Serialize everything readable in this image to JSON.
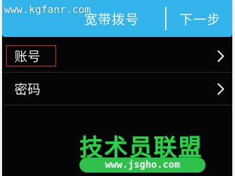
{
  "header": {
    "title": "宽带拨号",
    "next_label": "下一步"
  },
  "form": {
    "rows": [
      {
        "label": "账号",
        "icon": "chevron-right-icon"
      },
      {
        "label": "密码",
        "icon": "chevron-right-icon"
      }
    ]
  },
  "watermarks": {
    "top_url": "www.kgfanr.com",
    "logo_text": "技术员联盟",
    "logo_url": "www.jsgho.com"
  },
  "colors": {
    "header_bg": "#33b5ec",
    "page_bg": "#050505",
    "highlight": "#d0302f",
    "logo_green": "#2fd04a"
  }
}
